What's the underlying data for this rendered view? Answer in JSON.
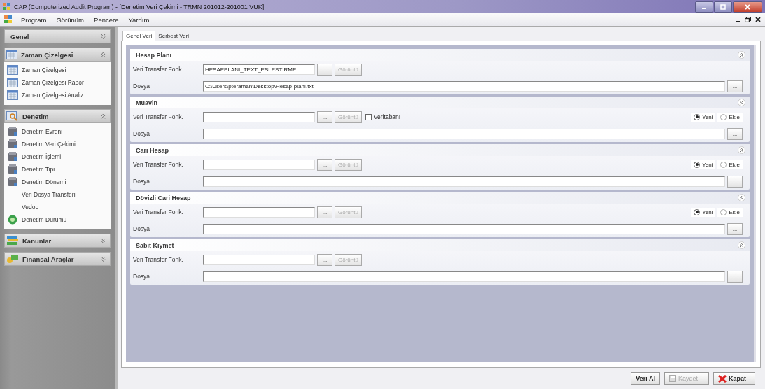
{
  "window": {
    "title": "CAP (Computerized Audit Program) - [Denetim Veri Çekimi - TRMN  201012-201001 VUK]"
  },
  "menu": [
    "Program",
    "Görünüm",
    "Pencere",
    "Yardım"
  ],
  "sidebar": {
    "groups": [
      {
        "title": "Genel",
        "expanded": false
      },
      {
        "title": "Zaman Çizelgesi",
        "expanded": true,
        "items": [
          {
            "label": "Zaman Çizelgesi",
            "kind": "icon"
          },
          {
            "label": "Zaman Çizelgesi Rapor",
            "kind": "icon"
          },
          {
            "label": "Zaman Çizelgesi Analiz",
            "kind": "icon"
          }
        ]
      },
      {
        "title": "Denetim",
        "expanded": true,
        "items": [
          {
            "label": "Denetim Evreni",
            "kind": "icon"
          },
          {
            "label": "Denetim Veri Çekimi",
            "kind": "icon"
          },
          {
            "label": "Denetim İşlemi",
            "kind": "icon"
          },
          {
            "label": "Denetim Tipi",
            "kind": "icon"
          },
          {
            "label": "Denetim Dönemi",
            "kind": "icon"
          },
          {
            "label": "Veri Dosya Transferi",
            "kind": "text"
          },
          {
            "label": "Vedop",
            "kind": "text"
          },
          {
            "label": "Denetim Durumu",
            "kind": "status"
          }
        ]
      },
      {
        "title": "Kanunlar",
        "expanded": false
      },
      {
        "title": "Finansal Araçlar",
        "expanded": false
      }
    ]
  },
  "tabs": [
    {
      "label": "Genel Veri",
      "selected": true
    },
    {
      "label": "Serbest Veri",
      "selected": false
    }
  ],
  "sections": [
    {
      "title": "Hesap Planı",
      "expanded": true,
      "transfer_label": "Veri Transfer Fonk.",
      "transfer_value": "HESAPPLANI_TEXT_ESLESTIRME",
      "browse": "...",
      "view": {
        "label": "Görüntü",
        "disabled": true
      },
      "file_label": "Dosya",
      "file_value": "C:\\Users\\pteraman\\Desktop\\Hesap-planı.txt",
      "file_browse": "..."
    },
    {
      "title": "Muavin",
      "expanded": true,
      "transfer_label": "Veri Transfer Fonk.",
      "browse": "...",
      "view": {
        "label": "Görüntü",
        "disabled": true
      },
      "checkbox": {
        "label": "Veritabanı",
        "checked": false
      },
      "options": [
        {
          "label": "Yeni",
          "selected": true
        },
        {
          "label": "Ekle",
          "selected": false
        }
      ],
      "file_label": "Dosya",
      "file_browse": "..."
    },
    {
      "title": "Cari Hesap",
      "expanded": true,
      "transfer_label": "Veri Transfer Fonk.",
      "browse": "...",
      "view": {
        "label": "Görüntü",
        "disabled": true
      },
      "options": [
        {
          "label": "Yeni",
          "selected": true
        },
        {
          "label": "Ekle",
          "selected": false
        }
      ],
      "file_label": "Dosya",
      "file_browse": "..."
    },
    {
      "title": "Dövizli Cari Hesap",
      "expanded": true,
      "transfer_label": "Veri Transfer Fonk.",
      "browse": "...",
      "view": {
        "label": "Görüntü",
        "disabled": true
      },
      "options": [
        {
          "label": "Yeni",
          "selected": true
        },
        {
          "label": "Ekle",
          "selected": false
        }
      ],
      "file_label": "Dosya",
      "file_browse": "..."
    },
    {
      "title": "Sabit Kıymet",
      "expanded": true,
      "transfer_label": "Veri Transfer Fonk.",
      "browse": "...",
      "view": {
        "label": "Görüntü",
        "disabled": true
      },
      "file_label": "Dosya",
      "file_browse": "..."
    }
  ],
  "buttons": [
    {
      "label": "Veri Al",
      "kind": "plain",
      "disabled": false
    },
    {
      "label": "Kaydet",
      "kind": "save",
      "disabled": true
    },
    {
      "label": "Kapat",
      "kind": "close",
      "disabled": false
    }
  ]
}
